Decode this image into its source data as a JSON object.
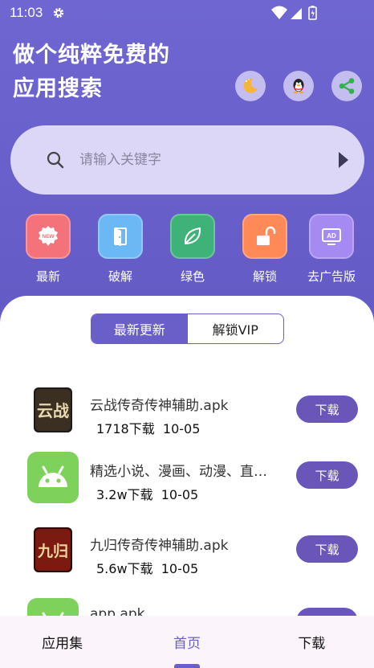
{
  "status_bar": {
    "time": "11:03"
  },
  "header": {
    "line1": "做个纯粹免费的",
    "line2": "应用搜索",
    "icons": [
      "moon-icon",
      "qq-penguin-icon",
      "share-icon"
    ]
  },
  "search": {
    "placeholder": "请输入关键字",
    "value": ""
  },
  "quick_actions": [
    {
      "label": "最新",
      "icon": "new-badge-icon",
      "color": "#f4737b",
      "badge": "NEW"
    },
    {
      "label": "破解",
      "icon": "door-icon",
      "color": "#6cb8f5"
    },
    {
      "label": "绿色",
      "icon": "leaf-icon",
      "color": "#3fb27a"
    },
    {
      "label": "解锁",
      "icon": "unlock-icon",
      "color": "#ff8a57"
    },
    {
      "label": "去广告版",
      "icon": "ad-screen-icon",
      "color": "#a58af2",
      "badge": "AD"
    }
  ],
  "segment": {
    "options": [
      "最新更新",
      "解锁VIP"
    ],
    "selected": "最新更新"
  },
  "apps": [
    {
      "name": "云战传奇传神辅助.apk",
      "downloads": "1718下载",
      "date": "10-05",
      "icon": "yunzhan-game-icon",
      "thumb_text": "云战",
      "button": "下载"
    },
    {
      "name": "精选小说、漫画、动漫、直播.apk",
      "downloads": "3.2w下载",
      "date": "10-05",
      "icon": "android-icon",
      "button": "下载"
    },
    {
      "name": "九归传奇传神辅助.apk",
      "downloads": "5.6w下载",
      "date": "10-05",
      "icon": "jiugui-game-icon",
      "thumb_text": "九归",
      "button": "下载"
    },
    {
      "name": "app.apk",
      "downloads": "",
      "date": "",
      "icon": "android-icon",
      "button": "下载"
    }
  ],
  "bottom_nav": {
    "tabs": [
      "应用集",
      "首页",
      "下载"
    ],
    "active": "首页"
  },
  "colors": {
    "accent": "#6a5fc9",
    "download_button": "#6a55b8"
  }
}
